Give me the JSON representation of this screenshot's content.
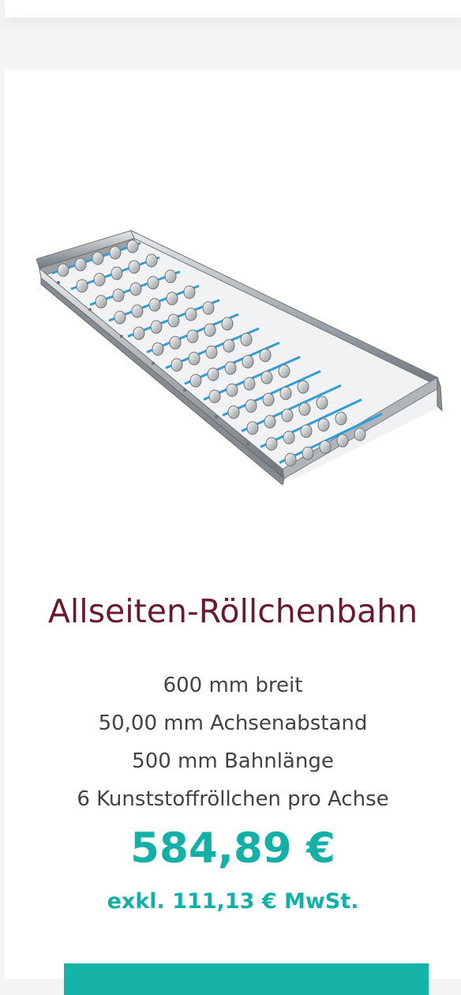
{
  "product": {
    "image_alt": "Allseiten-Röllchenbahn",
    "title": "Allseiten-Röllchenbahn",
    "specs": [
      "600 mm breit",
      "50,00 mm  Achsenabstand",
      "500 mm Bahnlänge",
      "6 Kunststoffröllchen pro Achse"
    ],
    "price": "584,89 €",
    "vat_note": "exkl. 111,13 € MwSt."
  },
  "colors": {
    "title": "#6b1a2e",
    "accent": "#14b0a8",
    "text": "#424242",
    "background": "#f4f4f4",
    "card": "#ffffff"
  }
}
